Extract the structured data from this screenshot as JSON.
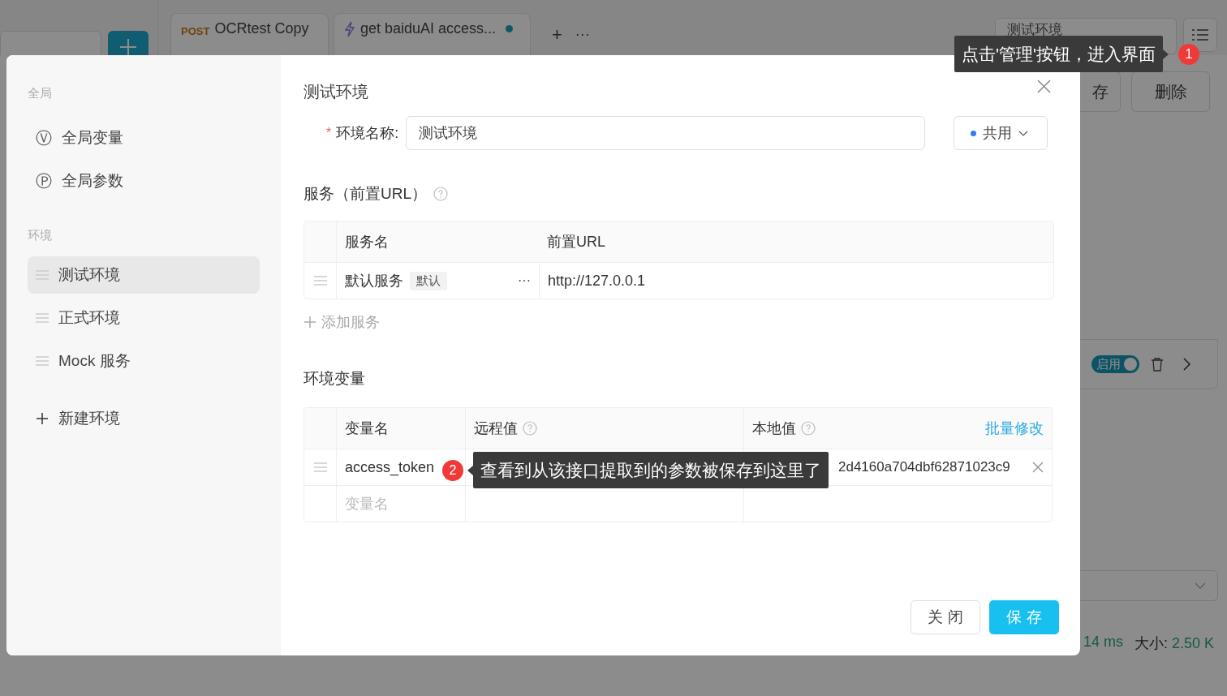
{
  "app": {
    "tabs": [
      {
        "kind": "http",
        "method": "POST",
        "title": "OCRtest Copy",
        "unsaved": false
      },
      {
        "kind": "script",
        "title": "get baiduAI access...",
        "unsaved": true
      }
    ],
    "new_tab": "+",
    "more_tabs": "···",
    "environment_select": "测试环境",
    "save_button": "存",
    "delete_button": "删除",
    "assertion": {
      "toggle_label": "启用",
      "enabled": true
    },
    "response": {
      "time": "14 ms",
      "size_label": "大小:",
      "size": "2.50 K"
    }
  },
  "modal": {
    "sidebar": [
      {
        "title": "全局",
        "items": [
          {
            "kind": "global",
            "icon": "Ⓥ",
            "label": "全局变量",
            "selected": false
          },
          {
            "kind": "global",
            "icon": "Ⓟ",
            "label": "全局参数",
            "selected": false
          }
        ]
      },
      {
        "title": "环境",
        "items": [
          {
            "kind": "env",
            "label": "测试环境",
            "selected": true
          },
          {
            "kind": "env",
            "label": "正式环境",
            "selected": false
          },
          {
            "kind": "env",
            "label": "Mock 服务",
            "selected": false
          },
          {
            "kind": "new",
            "label": "新建环境",
            "selected": false
          }
        ]
      }
    ],
    "title": "测试环境",
    "name_field": {
      "required_mark": "*",
      "label": "环境名称:",
      "value": "测试环境"
    },
    "scope_select": "共用",
    "services": {
      "title": "服务（前置URL）",
      "columns": [
        "服务名",
        "前置URL"
      ],
      "rows": [
        {
          "name": "默认服务",
          "tag": "默认",
          "more": "···",
          "url": "http://127.0.0.1"
        }
      ],
      "add": "添加服务"
    },
    "variables": {
      "title": "环境变量",
      "columns": [
        "变量名",
        "远程值",
        "本地值"
      ],
      "bulk_edit": "批量修改",
      "rows": [
        {
          "name": "access_token",
          "local_value": "2d4160a704dbf62871023c9"
        }
      ],
      "name_placeholder": "变量名"
    },
    "close_button": "关 闭",
    "save_button": "保 存"
  },
  "tips": [
    {
      "number": "1",
      "text": "点击'管理'按钮，进入界面"
    },
    {
      "number": "2",
      "text": "查看到从该接口提取到的参数被保存到这里了"
    }
  ]
}
